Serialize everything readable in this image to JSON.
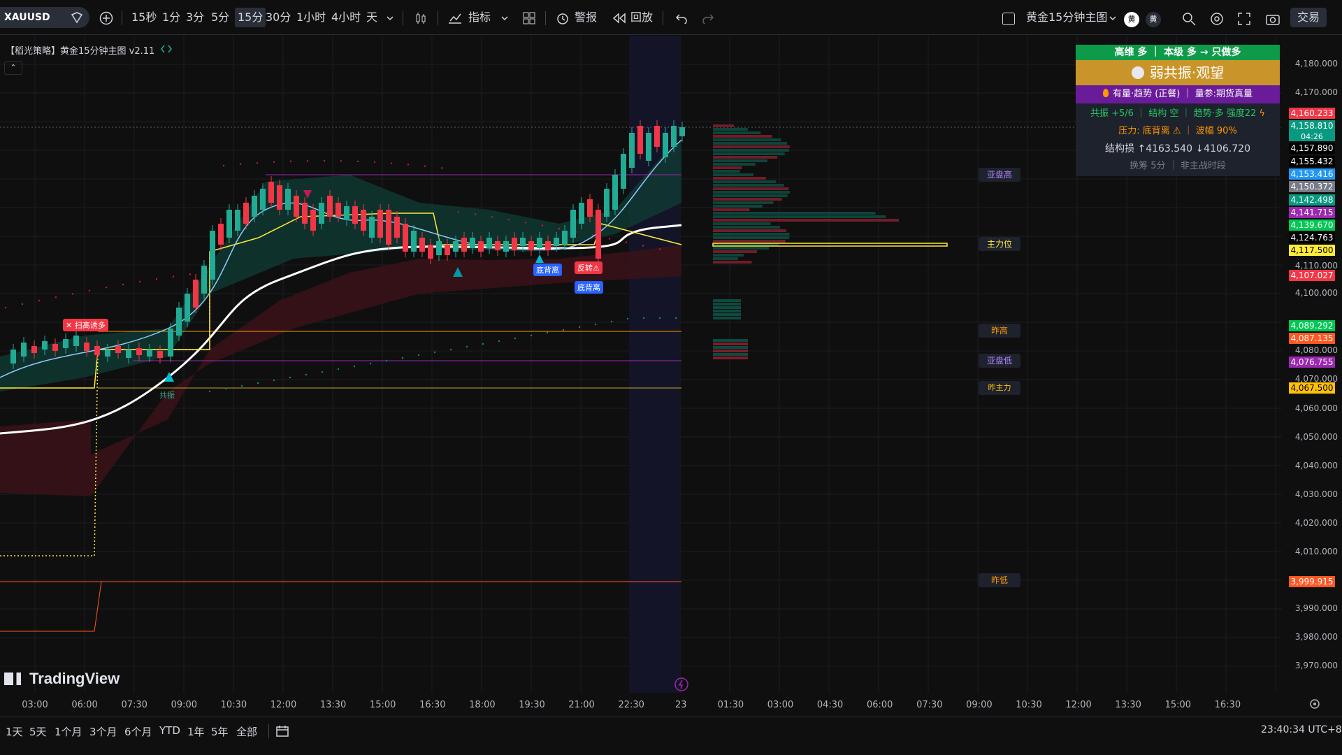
{
  "toolbar": {
    "symbol": "XAUUSD",
    "intervals": [
      "15秒",
      "1分",
      "3分",
      "5分",
      "15分",
      "30分",
      "1小时",
      "4小时",
      "天"
    ],
    "active_interval": "15分",
    "indicators_label": "指标",
    "alert_label": "警报",
    "replay_label": "回放",
    "layout_name": "黄金15分钟主图",
    "trade_label": "交易",
    "avatar_text": "黄"
  },
  "indicator": {
    "title": "【稻光策略】黄金15分钟主图 v2.11",
    "collapse_glyph": "⌃"
  },
  "panel": {
    "row1": "高维 多 ｜ 本级 多 → 只做多",
    "row2": "弱共振·观望",
    "row3": "有量·趋势 (正餐) ｜ 量参:期货真量",
    "row4": "共振 +5/6 ｜ 结构 空 ｜ 趋势·多 强度22",
    "row5": "压力: 底背离 ⚠ ｜ 波幅 90%",
    "row6": "结构损  ↑4163.540  ↓4106.720",
    "row7": "换筹 5分 ｜ 非主战时段",
    "colors": {
      "row1": "#0d9b4a",
      "row2": "#c9952a",
      "row3": "#6a1b9a"
    }
  },
  "level_labels": [
    "亚盘高",
    "主力位",
    "昨高",
    "亚盘低",
    "昨主力",
    "昨低"
  ],
  "signal_labels": {
    "sell": "✕ 扫高诱多",
    "resonance": "共振",
    "divergence1": "底背离",
    "reversal": "反转⚠",
    "divergence2": "底背离"
  },
  "price_axis": {
    "ticks": [
      "4,180.000",
      "4,170.000",
      "4,110.000",
      "4,100.000",
      "4,080.000",
      "4,070.000",
      "4,060.000",
      "4,050.000",
      "4,040.000",
      "4,030.000",
      "4,020.000",
      "4,010.000",
      "3,990.000",
      "3,980.000",
      "3,970.000"
    ],
    "tags": [
      {
        "value": "4,160.233",
        "color": "#f23645"
      },
      {
        "value": "4,158.810",
        "sub": "04:26",
        "color": "#089981"
      },
      {
        "value": "4,157.890",
        "color": "#000000"
      },
      {
        "value": "4,155.432",
        "color": "#000000"
      },
      {
        "value": "4,153.416",
        "color": "#2196f3"
      },
      {
        "value": "4,150.372",
        "color": "#787b86"
      },
      {
        "value": "4,142.498",
        "color": "#089981"
      },
      {
        "value": "4,141.715",
        "color": "#9c27b0"
      },
      {
        "value": "4,139.670",
        "color": "#00c853"
      },
      {
        "value": "4,124.763",
        "color": "#000000"
      },
      {
        "value": "4,117.500",
        "color": "#ffeb3b"
      },
      {
        "value": "4,107.027",
        "color": "#f23645"
      },
      {
        "value": "4,089.292",
        "color": "#00c853"
      },
      {
        "value": "4,087.135",
        "color": "#ff5722"
      },
      {
        "value": "4,076.755",
        "color": "#9c27b0"
      },
      {
        "value": "4,067.500",
        "color": "#ffc107"
      },
      {
        "value": "3,999.915",
        "color": "#ff5722"
      }
    ]
  },
  "time_axis": [
    "03:00",
    "06:00",
    "07:30",
    "09:00",
    "10:30",
    "12:00",
    "13:30",
    "15:00",
    "16:30",
    "18:00",
    "19:30",
    "21:00",
    "22:30",
    "23",
    "01:30",
    "03:00",
    "04:30",
    "06:00",
    "07:30",
    "09:00",
    "10:30",
    "12:00",
    "13:30",
    "15:00",
    "16:30"
  ],
  "bottom": {
    "ranges": [
      "1天",
      "5天",
      "1个月",
      "3个月",
      "6个月",
      "YTD",
      "1年",
      "5年",
      "全部"
    ],
    "clock": "23:40:34 UTC+8"
  },
  "brand": "TradingView"
}
